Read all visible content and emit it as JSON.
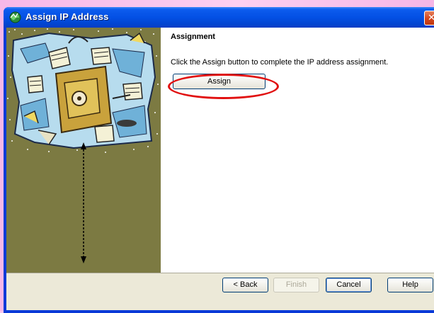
{
  "window": {
    "title": "Assign IP Address",
    "close_glyph": "✕",
    "icon": "network-globe-icon"
  },
  "wizard": {
    "section_title": "Assignment",
    "instruction": "Click the Assign button to complete the IP address assignment.",
    "assign_label": "Assign"
  },
  "footer": {
    "back_label": "< Back",
    "finish_label": "Finish",
    "cancel_label": "Cancel",
    "help_label": "Help"
  },
  "colors": {
    "titlebar": "#0350e4",
    "left_panel": "#7c7a42",
    "annotation_red": "#e11010"
  }
}
